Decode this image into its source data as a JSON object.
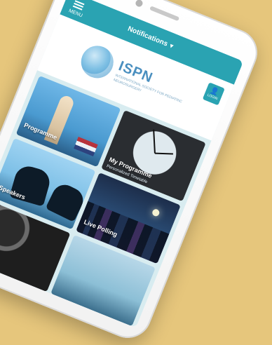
{
  "header": {
    "menu_label": "MENU",
    "notifications_label": "Notifications"
  },
  "banner": {
    "logo_name": "ISPN",
    "logo_subtitle": "INTERNATIONAL SOCIETY FOR PEDIATRIC NEUROSURGERY",
    "login_label": "LOGIN"
  },
  "tiles": [
    {
      "label": "Programme",
      "sub": ""
    },
    {
      "label": "My Programme",
      "sub": "Personalized Timetable"
    },
    {
      "label": "Speakers",
      "sub": ""
    },
    {
      "label": "Live Polling",
      "sub": ""
    },
    {
      "label": "",
      "sub": ""
    },
    {
      "label": "",
      "sub": ""
    }
  ],
  "colors": {
    "background": "#e6c67c",
    "accent": "#2aa3b2",
    "brand": "#4a8fbf"
  }
}
